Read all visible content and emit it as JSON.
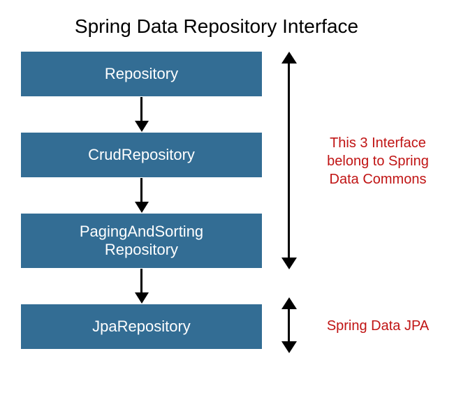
{
  "title": "Spring Data Repository Interface",
  "boxes": {
    "repository": "Repository",
    "crud": "CrudRepository",
    "paging_line1": "PagingAndSorting",
    "paging_line2": "Repository",
    "jpa": "JpaRepository"
  },
  "annotations": {
    "commons_line1": "This 3 Interface",
    "commons_line2": "belong to Spring",
    "commons_line3": "Data Commons",
    "jpa": "Spring Data JPA"
  },
  "colors": {
    "box_bg": "#336d94",
    "box_text": "#ffffff",
    "annotation": "#c01414"
  }
}
